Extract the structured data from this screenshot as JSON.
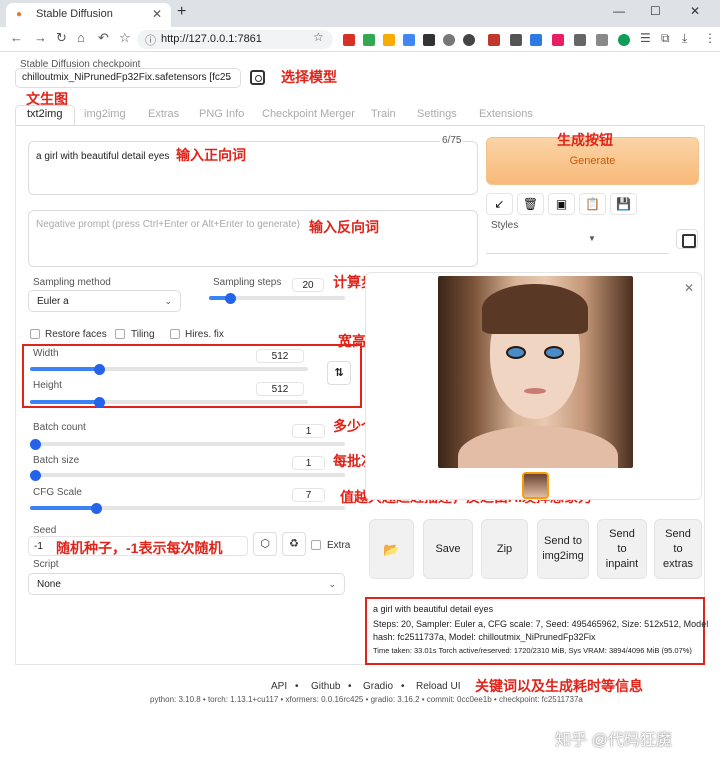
{
  "browser": {
    "tab_title": "Stable Diffusion",
    "url": "http://127.0.0.1:7861"
  },
  "checkpoint": {
    "label": "Stable Diffusion checkpoint",
    "value": "chilloutmix_NiPrunedFp32Fix.safetensors [fc25"
  },
  "tabs": [
    "txt2img",
    "img2img",
    "Extras",
    "PNG Info",
    "Checkpoint Merger",
    "Train",
    "Settings",
    "Extensions"
  ],
  "prompt": {
    "positive": "a girl with beautiful detail eyes",
    "token_count": "6/75",
    "negative_placeholder": "Negative prompt (press Ctrl+Enter or Alt+Enter to generate)"
  },
  "generate_label": "Generate",
  "styles_label": "Styles",
  "sampling": {
    "method_label": "Sampling method",
    "method_value": "Euler a",
    "steps_label": "Sampling steps",
    "steps_value": "20",
    "steps_fraction": 0.13
  },
  "options": {
    "restore_faces": "Restore faces",
    "tiling": "Tiling",
    "hires_fix": "Hires. fix"
  },
  "size": {
    "width_label": "Width",
    "width_value": "512",
    "width_fraction": 0.24,
    "height_label": "Height",
    "height_value": "512",
    "height_fraction": 0.24
  },
  "batch": {
    "count_label": "Batch count",
    "count_value": "1",
    "count_fraction": 0.0,
    "size_label": "Batch size",
    "size_value": "1",
    "size_fraction": 0.0
  },
  "cfg": {
    "label": "CFG Scale",
    "value": "7",
    "fraction": 0.2
  },
  "seed": {
    "label": "Seed",
    "value": "-1",
    "extra_label": "Extra"
  },
  "script": {
    "label": "Script",
    "value": "None"
  },
  "output_buttons": {
    "save": "Save",
    "zip": "Zip",
    "send_img2img_1": "Send to",
    "send_img2img_2": "img2img",
    "send_inpaint_1": "Send",
    "send_inpaint_2": "to",
    "send_inpaint_3": "inpaint",
    "send_extras_1": "Send",
    "send_extras_2": "to",
    "send_extras_3": "extras"
  },
  "info": {
    "prompt": "a girl with beautiful detail eyes",
    "params_1": "Steps: 20, Sampler: Euler a, CFG scale: 7, Seed: 495465962, Size: 512x512, Model",
    "params_2": "hash: fc2511737a, Model: chilloutmix_NiPrunedFp32Fix",
    "timing": "Time taken: 33.01s  Torch active/reserved: 1720/2310 MiB, Sys VRAM: 3894/4096 MiB (95.07%)"
  },
  "footer": {
    "api": "API",
    "github": "Github",
    "gradio": "Gradio",
    "reload": "Reload UI",
    "sep": "•",
    "meta": "python: 3.10.8  •  torch: 1.13.1+cu117  •  xformers: 0.0.16rc425  •  gradio: 3.16.2  •  commit: 0cc0ee1b  •  checkpoint: fc2511737a"
  },
  "annotations": {
    "select_model": "选择模型",
    "txt2img": "文生图",
    "positive": "输入正向词",
    "generate": "生成按钮",
    "negative": "输入反向词",
    "steps": "计算步数",
    "size": "宽高设置",
    "batch_count": "多少个批次",
    "batch_size": "每批次几张",
    "cfg": "值越大越趋近描述，反之由AI发挥想象力",
    "seed": "随机种子，-1表示每次随机",
    "info": "关键词以及生成耗时等信息"
  },
  "watermark": "知乎 @代码狂魔"
}
